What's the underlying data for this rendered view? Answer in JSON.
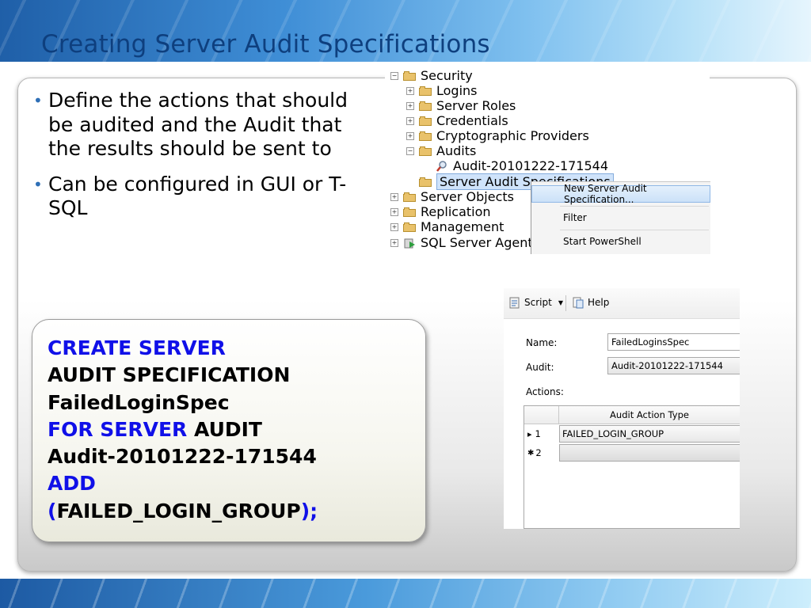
{
  "slide": {
    "title": "Creating Server Audit Specifications",
    "bullets": [
      "Define the actions that should be audited and the Audit that the results should be sent to",
      "Can be configured in GUI or T-SQL"
    ]
  },
  "code": {
    "line1_kw": "CREATE SERVER",
    "line2": "AUDIT SPECIFICATION",
    "line3": "FailedLoginSpec",
    "line4_kw": "FOR SERVER",
    "line4_rest": " AUDIT",
    "line5": "Audit-20101222-171544",
    "line6_kw": "ADD",
    "line7_open": "(",
    "line7_body": "FAILED_LOGIN_GROUP",
    "line7_close": ");"
  },
  "explorer": {
    "security": "Security",
    "logins": "Logins",
    "server_roles": "Server Roles",
    "credentials": "Credentials",
    "crypto": "Cryptographic Providers",
    "audits": "Audits",
    "audit_item": "Audit-20101222-171544",
    "server_audit_specs": "Server Audit Specifications",
    "server_objects": "Server Objects",
    "replication": "Replication",
    "management": "Management",
    "sql_agent": "SQL Server Agent",
    "expand_minus": "−",
    "expand_plus": "+"
  },
  "context_menu": {
    "new_spec": "New Server Audit Specification...",
    "filter": "Filter",
    "powershell": "Start PowerShell"
  },
  "dialog": {
    "script": "Script",
    "help": "Help",
    "name_label": "Name:",
    "name_value": "FailedLoginsSpec",
    "audit_label": "Audit:",
    "audit_value": "Audit-20101222-171544",
    "actions_label": "Actions:",
    "col_header": "Audit Action Type",
    "row1_num": "1",
    "row1_value": "FAILED_LOGIN_GROUP",
    "row2_num": "2",
    "row1_marker": "▸",
    "row2_marker": "✱"
  },
  "colors": {
    "title": "#0e3f7e",
    "keyword": "#1010e8",
    "bullet": "#2e6fb6"
  }
}
